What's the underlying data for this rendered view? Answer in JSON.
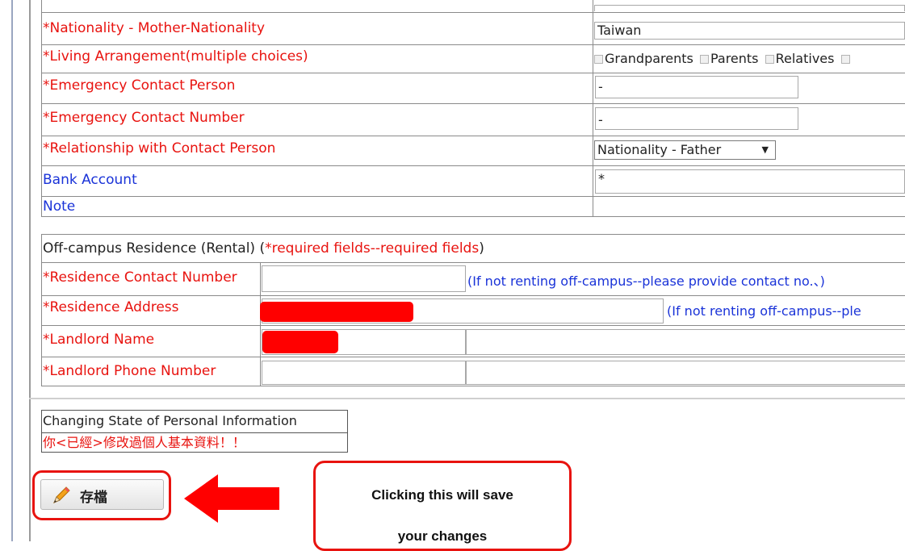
{
  "personal_rows": [
    {
      "label": "*Nationality - Mother-Nationality",
      "color": "red"
    },
    {
      "label": "*Living Arrangement(multiple choices)",
      "color": "red"
    },
    {
      "label": "*Emergency Contact Person",
      "color": "red"
    },
    {
      "label": "*Emergency Contact Number",
      "color": "red"
    },
    {
      "label": "*Relationship with Contact Person",
      "color": "red"
    },
    {
      "label": "Bank Account",
      "color": "blue"
    },
    {
      "label": "Note",
      "color": "blue"
    }
  ],
  "fields": {
    "mother_nationality": "Taiwan",
    "living_options": [
      "Grandparents",
      "Parents",
      "Relatives"
    ],
    "emergency_person": "-",
    "emergency_number": "-",
    "relationship_select": "Nationality - Father",
    "bank_account": "*"
  },
  "residence": {
    "header_prefix": "Off-campus Residence (Rental)  (",
    "header_required": "*required fields--required fields",
    "header_suffix": ")",
    "contact_label": "*Residence Contact Number",
    "contact_hint": "(If not renting off-campus--please provide contact no.、)",
    "address_label": "*Residence Address",
    "address_hint": "(If not renting off-campus--ple",
    "landlord_label": "*Landlord Name",
    "landlord_phone_label": "*Landlord Phone Number"
  },
  "state": {
    "title": "Changing State of Personal Information",
    "message": "你<已經>修改過個人基本資料！！"
  },
  "save_button": {
    "label": "存檔",
    "icon": "pencil-icon"
  },
  "annotation": {
    "line1": "Clicking this will save",
    "line2": "your changes"
  },
  "colors": {
    "required_red": "#e8130f",
    "link_blue": "#1a33d8",
    "highlight_red": "#ff0000"
  }
}
